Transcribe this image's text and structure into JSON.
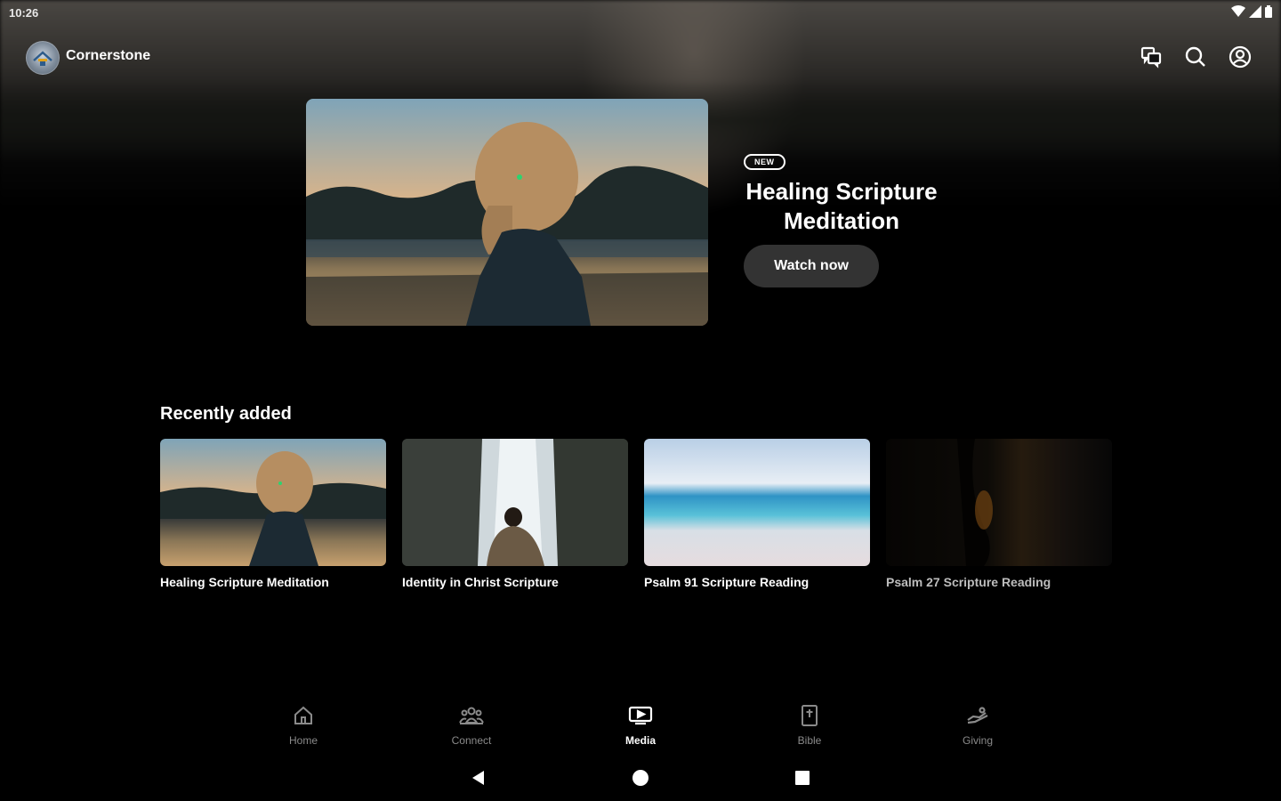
{
  "status_bar": {
    "time": "10:26",
    "icons": [
      "wifi-icon",
      "signal-icon",
      "battery-icon"
    ]
  },
  "app_bar": {
    "app_name": "Cornerstone",
    "actions": [
      "chat-icon",
      "search-icon",
      "account-icon"
    ]
  },
  "featured": {
    "badge": "NEW",
    "title": "Healing Scripture Meditation",
    "button_label": "Watch now"
  },
  "recently_added": {
    "title": "Recently added",
    "items": [
      {
        "title": "Healing Scripture Meditation"
      },
      {
        "title": "Identity in Christ Scripture"
      },
      {
        "title": "Psalm 91 Scripture Reading"
      },
      {
        "title": "Psalm 27 Scripture Reading"
      }
    ]
  },
  "bottom_nav": {
    "items": [
      {
        "label": "Home",
        "icon": "home-icon"
      },
      {
        "label": "Connect",
        "icon": "people-icon"
      },
      {
        "label": "Media",
        "icon": "media-icon",
        "active": true
      },
      {
        "label": "Bible",
        "icon": "bible-icon"
      },
      {
        "label": "Giving",
        "icon": "giving-icon"
      }
    ]
  },
  "colors": {
    "background": "#000000",
    "button_bg": "#333333",
    "inactive_nav": "#8a8a8a",
    "active_nav": "#ffffff"
  }
}
